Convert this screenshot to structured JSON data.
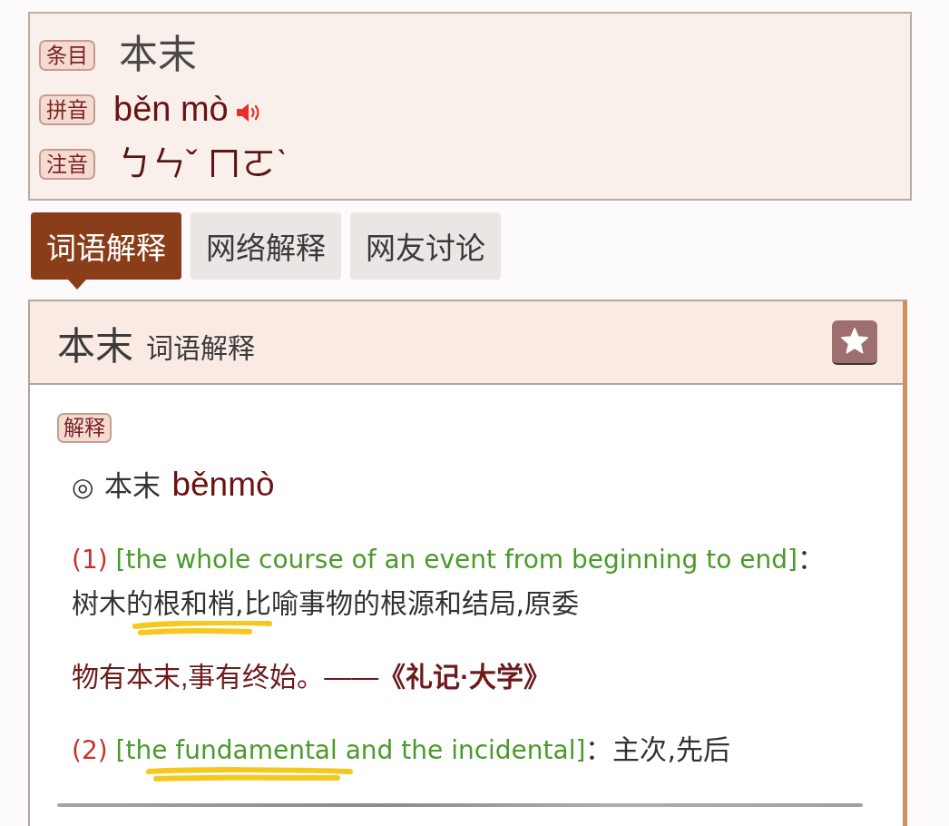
{
  "entry": {
    "rows": [
      {
        "label": "条目",
        "kind": "word",
        "value": "本末"
      },
      {
        "label": "拼音",
        "kind": "pinyin",
        "value": "běn mò"
      },
      {
        "label": "注音",
        "kind": "zhuyin",
        "value": "ㄅㄣˇ ㄇㄛˋ"
      }
    ]
  },
  "tabs": [
    {
      "label": "词语解释",
      "selected": true
    },
    {
      "label": "网络解释",
      "selected": false
    },
    {
      "label": "网友讨论",
      "selected": false
    }
  ],
  "panel": {
    "title": "本末",
    "subtitle": "词语解释",
    "badge": "解释",
    "headword": {
      "symbol": "◎",
      "word": "本末",
      "pinyin": "běnmò"
    },
    "senses": [
      {
        "number": "(1)",
        "english": "[the whole course of an event from beginning to end]",
        "meaning": "：树木的根和梢,比喻事物的根源和结局,原委",
        "examples": [
          "物有本末,事有终始。——**《礼记·大学》**"
        ]
      },
      {
        "number": "(2)",
        "english": "[the fundamental and the incidental]",
        "meaning": "：主次,先后"
      }
    ]
  }
}
